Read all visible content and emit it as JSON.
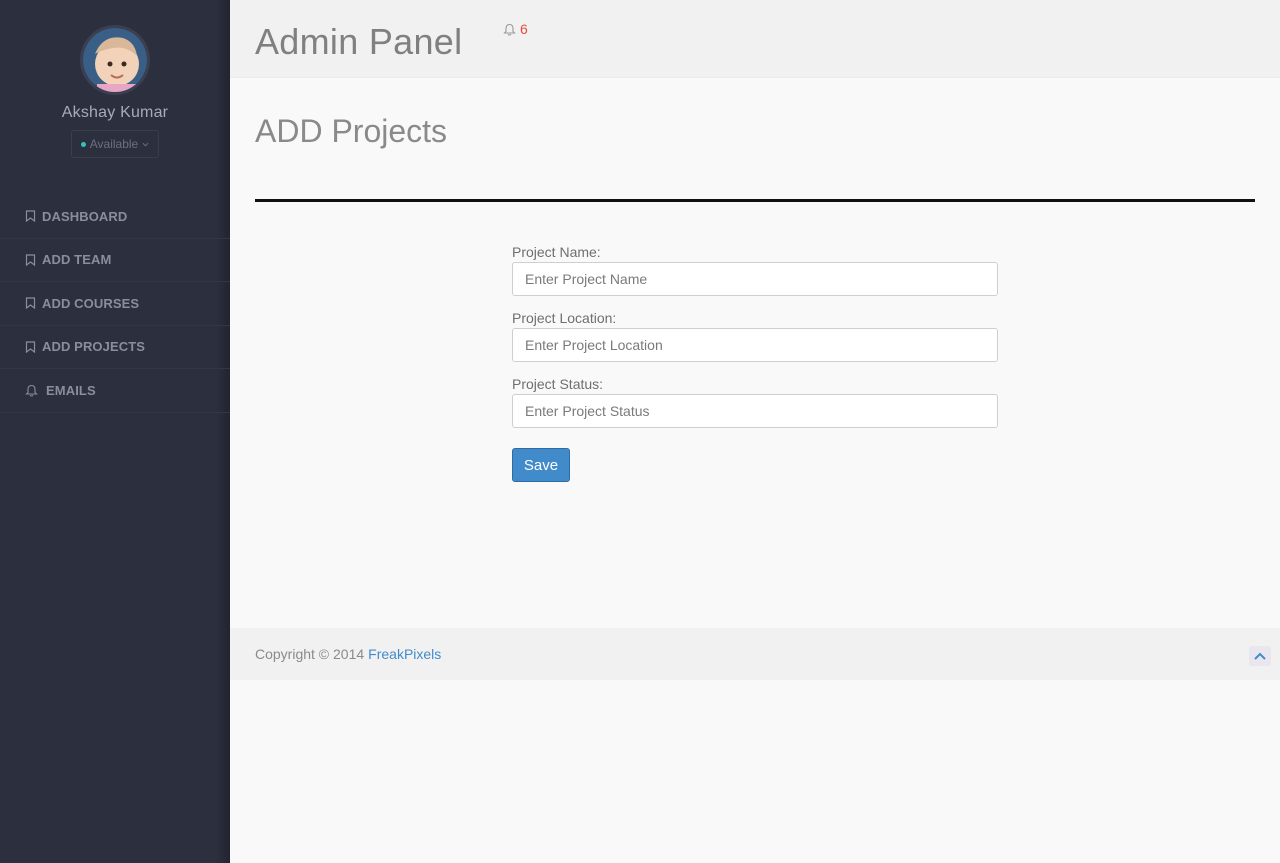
{
  "sidebar": {
    "user_name": "Akshay Kumar",
    "status": "Available",
    "items": [
      {
        "label": "DASHBOARD",
        "icon": "bookmark-icon"
      },
      {
        "label": "ADD TEAM",
        "icon": "bookmark-icon"
      },
      {
        "label": "ADD COURSES",
        "icon": "bookmark-icon"
      },
      {
        "label": "ADD PROJECTS",
        "icon": "bookmark-icon"
      },
      {
        "label": "EMAILS",
        "icon": "bell-icon"
      }
    ]
  },
  "header": {
    "brand": "Admin Panel",
    "notification_count": "6"
  },
  "main": {
    "title": "ADD Projects",
    "form": {
      "name_label": "Project Name:",
      "name_placeholder": "Enter Project Name",
      "location_label": "Project Location:",
      "location_placeholder": "Enter Project Location",
      "status_label": "Project Status:",
      "status_placeholder": "Enter Project Status",
      "save_label": "Save"
    }
  },
  "footer": {
    "copyright": "Copyright © 2014",
    "link": "FreakPixels"
  },
  "colors": {
    "sidebar_bg": "#2c2f3e",
    "accent": "#428bca",
    "notification": "#e74c3c",
    "status_dot": "#2ec4b6"
  }
}
